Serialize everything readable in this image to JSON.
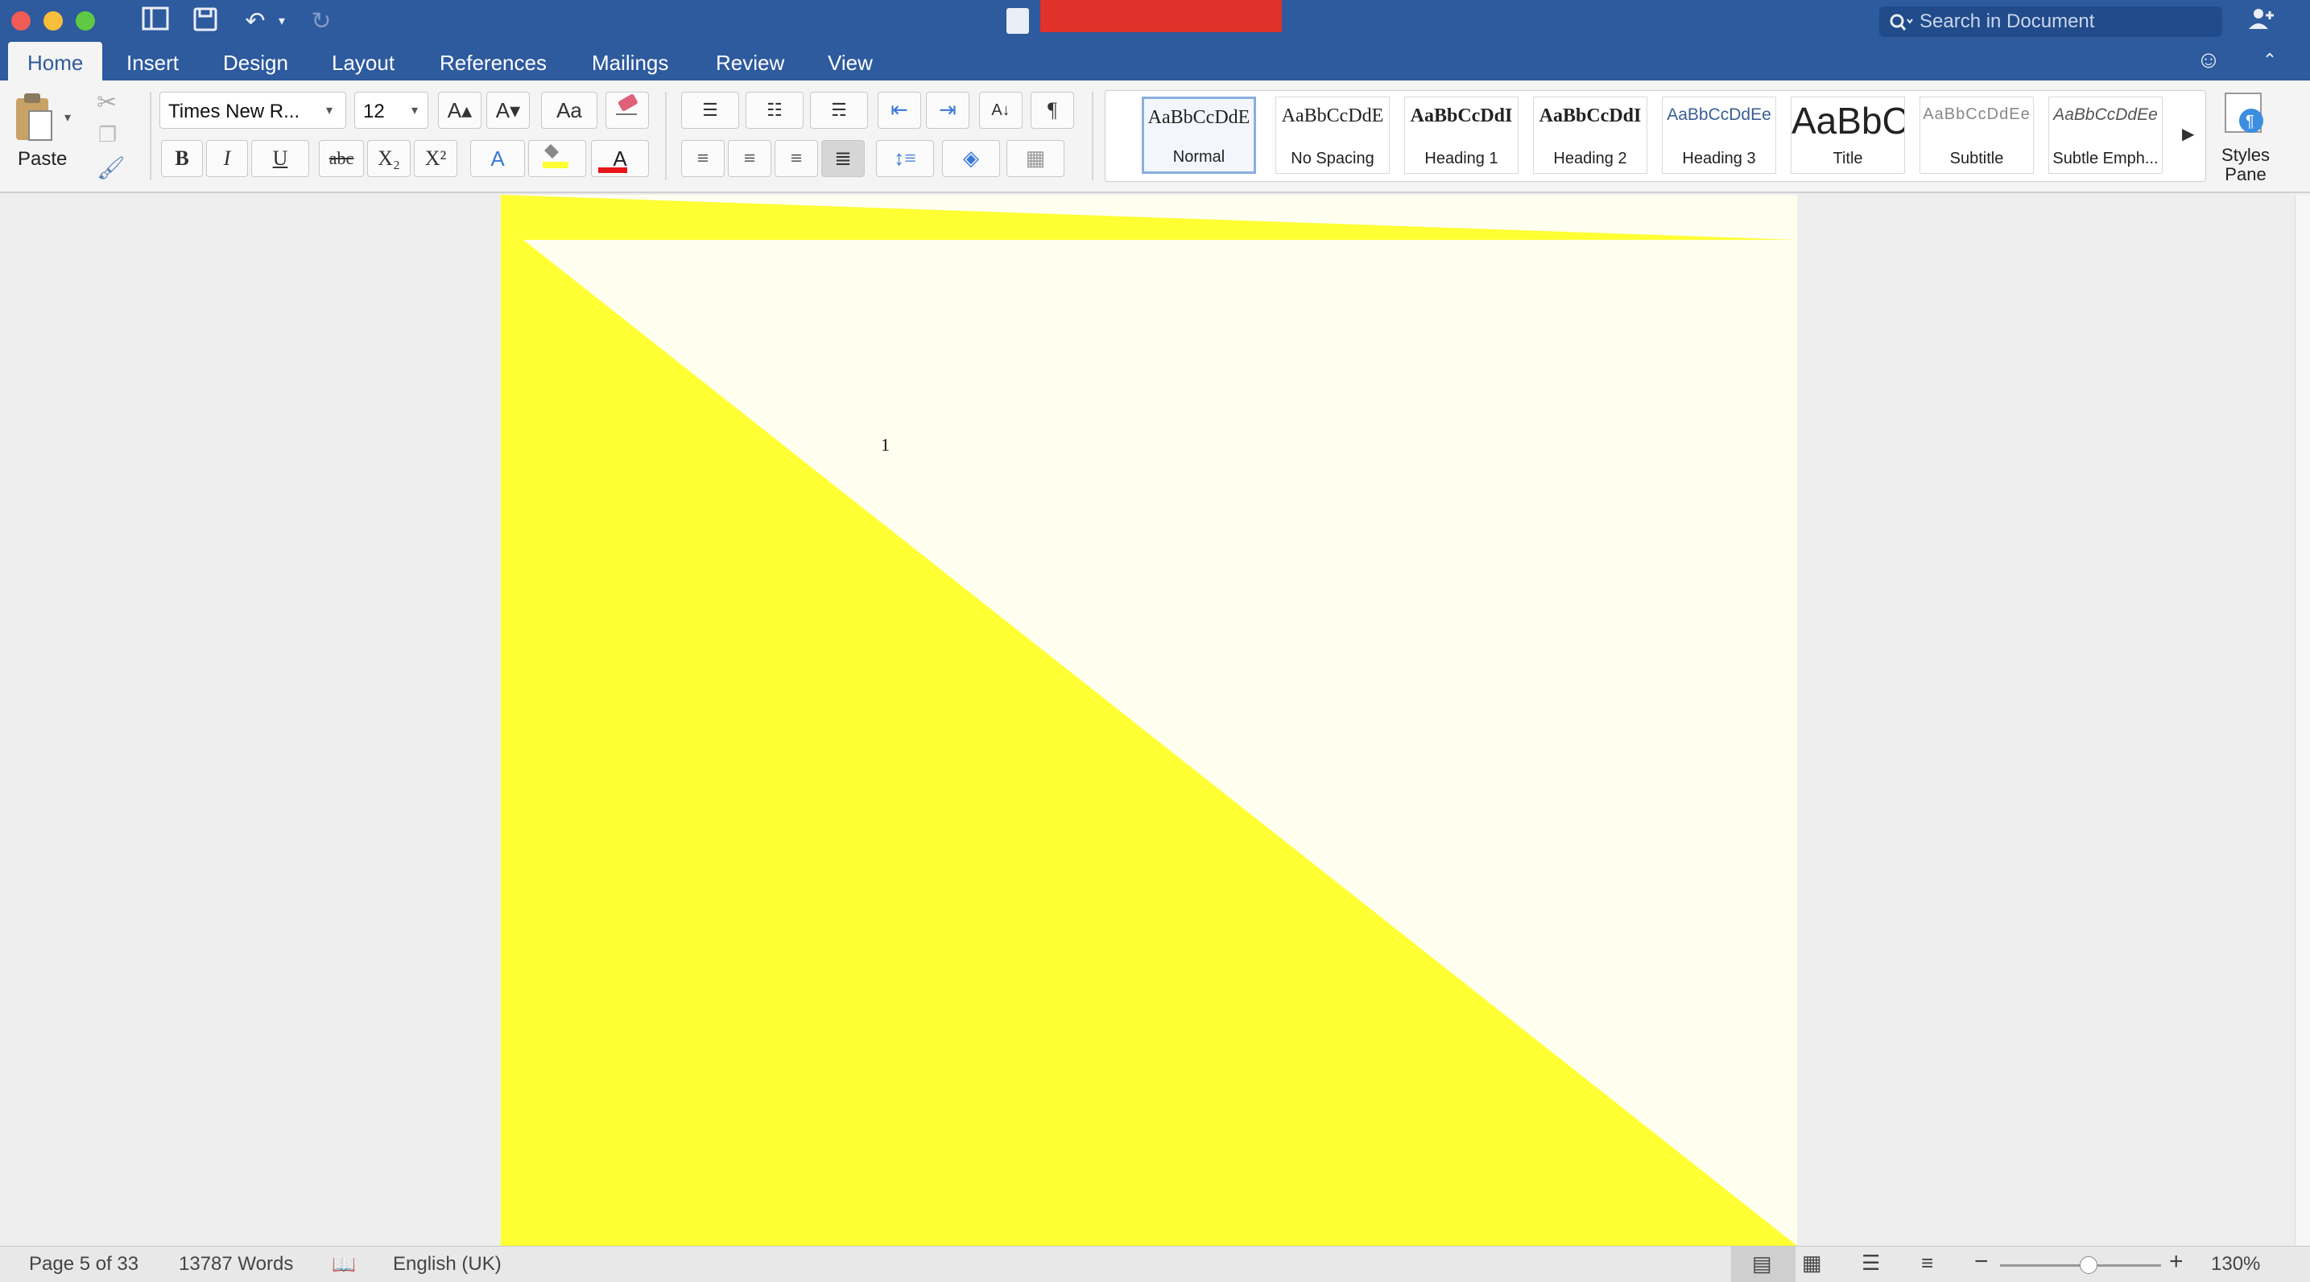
{
  "window": {
    "traffic_colors": {
      "close": "#ee5c55",
      "minimize": "#f6be3b",
      "zoom": "#5fc943"
    }
  },
  "search": {
    "placeholder": "Search in Document"
  },
  "tabs": [
    {
      "label": "Home",
      "active": true
    },
    {
      "label": "Insert"
    },
    {
      "label": "Design"
    },
    {
      "label": "Layout"
    },
    {
      "label": "References"
    },
    {
      "label": "Mailings"
    },
    {
      "label": "Review"
    },
    {
      "label": "View"
    }
  ],
  "ribbon": {
    "paste_label": "Paste",
    "font_name": "Times New R...",
    "font_size": "12",
    "bold": "B",
    "italic": "I",
    "underline": "U",
    "strikethrough": "abc",
    "subscript": "X₂",
    "superscript": "X²",
    "grow_font": "A▴",
    "shrink_font": "A▾",
    "change_case": "Aa",
    "text_effects": "A",
    "font_color": "A",
    "pilcrow": "¶",
    "styles": [
      {
        "preview": "AaBbCcDdE",
        "label": "Normal",
        "selected": true
      },
      {
        "preview": "AaBbCcDdE",
        "label": "No Spacing"
      },
      {
        "preview": "AaBbCcDdI",
        "label": "Heading 1"
      },
      {
        "preview": "AaBbCcDdI",
        "label": "Heading 2"
      },
      {
        "preview": "AaBbCcDdEe",
        "label": "Heading 3"
      },
      {
        "preview": "AaBbC",
        "label": "Title"
      },
      {
        "preview": "AaBbCcDdEe",
        "label": "Subtitle"
      },
      {
        "preview": "AaBbCcDdEe",
        "label": "Subtle Emph..."
      }
    ],
    "styles_pane_label_1": "Styles",
    "styles_pane_label_2": "Pane"
  },
  "document": {
    "page_number": "1",
    "highlight_color": "#ffff33",
    "page_color": "#fffff0"
  },
  "status": {
    "page": "Page 5 of 33",
    "words": "13787 Words",
    "language": "English (UK)",
    "zoom": "130%",
    "zoom_level": 0.55
  },
  "colors": {
    "accent": "#2e5a9e",
    "redaction": "#e0312a"
  }
}
